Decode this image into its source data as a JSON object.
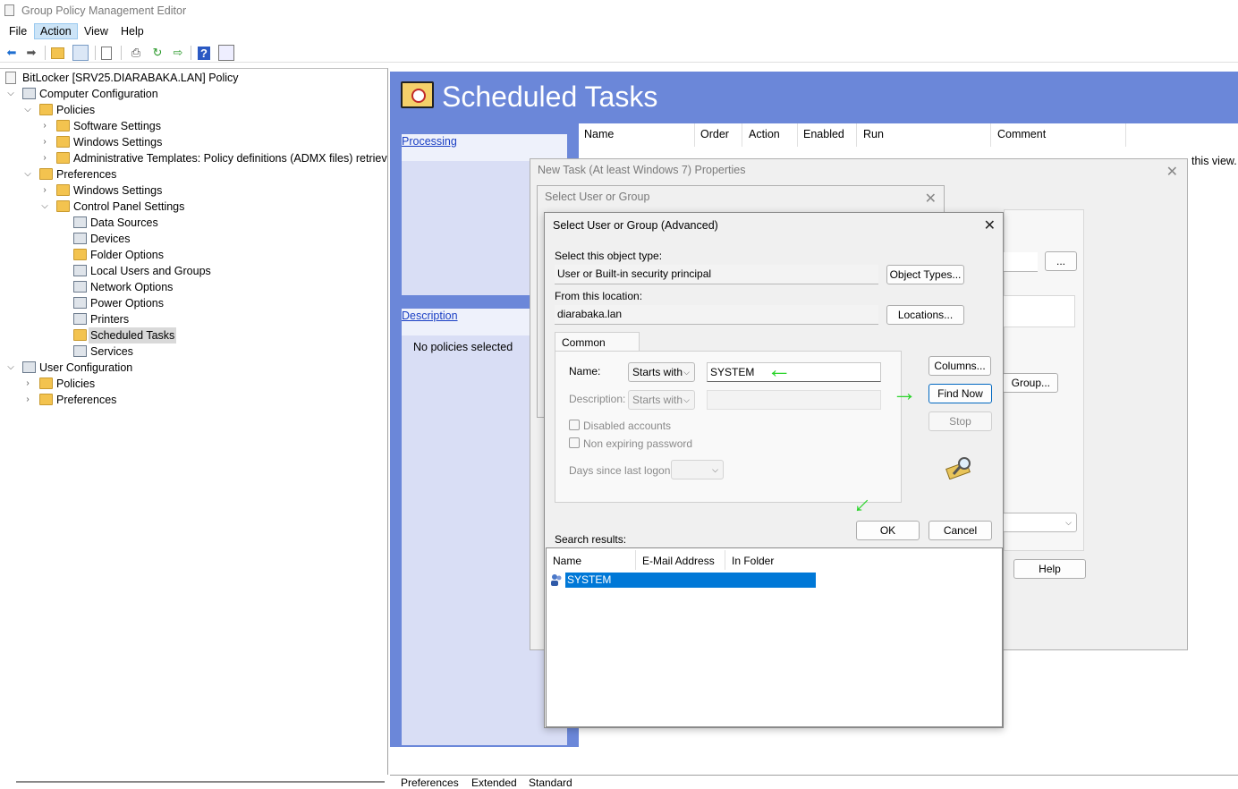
{
  "window": {
    "title": "Group Policy Management Editor"
  },
  "menu": [
    "File",
    "Action",
    "View",
    "Help"
  ],
  "tree": {
    "root": "BitLocker [SRV25.DIARABAKA.LAN] Policy",
    "computer_config": "Computer Configuration",
    "policies": "Policies",
    "software_settings": "Software Settings",
    "windows_settings": "Windows Settings",
    "admin_templates": "Administrative Templates: Policy definitions (ADMX files) retrieved",
    "preferences": "Preferences",
    "pref_windows_settings": "Windows Settings",
    "control_panel": "Control Panel Settings",
    "data_sources": "Data Sources",
    "devices": "Devices",
    "folder_options": "Folder Options",
    "local_users": "Local Users and Groups",
    "network_options": "Network Options",
    "power_options": "Power Options",
    "printers": "Printers",
    "scheduled_tasks": "Scheduled Tasks",
    "services": "Services",
    "user_config": "User Configuration",
    "user_policies": "Policies",
    "user_preferences": "Preferences"
  },
  "banner": {
    "title": "Scheduled Tasks"
  },
  "leftpane": {
    "processing": "Processing",
    "description": "Description",
    "no_policies": "No policies selected"
  },
  "grid": {
    "columns": [
      "Name",
      "Order",
      "Action",
      "Enabled",
      "Run",
      "Comment"
    ],
    "empty_msg": "this view."
  },
  "bottom_tabs": [
    "Preferences",
    "Extended",
    "Standard"
  ],
  "task_dialog": {
    "title": "New Task (At least Windows 7) Properties",
    "ellipsis": "...",
    "group_btn": "Group...",
    "help_btn": "Help"
  },
  "select_dialog": {
    "title": "Select User or Group"
  },
  "adv_dialog": {
    "title": "Select User or Group (Advanced)",
    "object_type_label": "Select this object type:",
    "object_type_value": "User or Built-in security principal",
    "object_types_btn": "Object Types...",
    "location_label": "From this location:",
    "location_value": "diarabaka.lan",
    "locations_btn": "Locations...",
    "tab": "Common Queries",
    "name_label": "Name:",
    "name_mode": "Starts with",
    "name_value": "SYSTEM",
    "desc_label": "Description:",
    "desc_mode": "Starts with",
    "disabled_accounts": "Disabled accounts",
    "non_expiring": "Non expiring password",
    "days_label": "Days since last logon:",
    "columns_btn": "Columns...",
    "find_btn": "Find Now",
    "stop_btn": "Stop",
    "ok_btn": "OK",
    "cancel_btn": "Cancel",
    "results_label": "Search results:",
    "results_columns": [
      "Name",
      "E-Mail Address",
      "In Folder"
    ],
    "result_row": "SYSTEM"
  }
}
